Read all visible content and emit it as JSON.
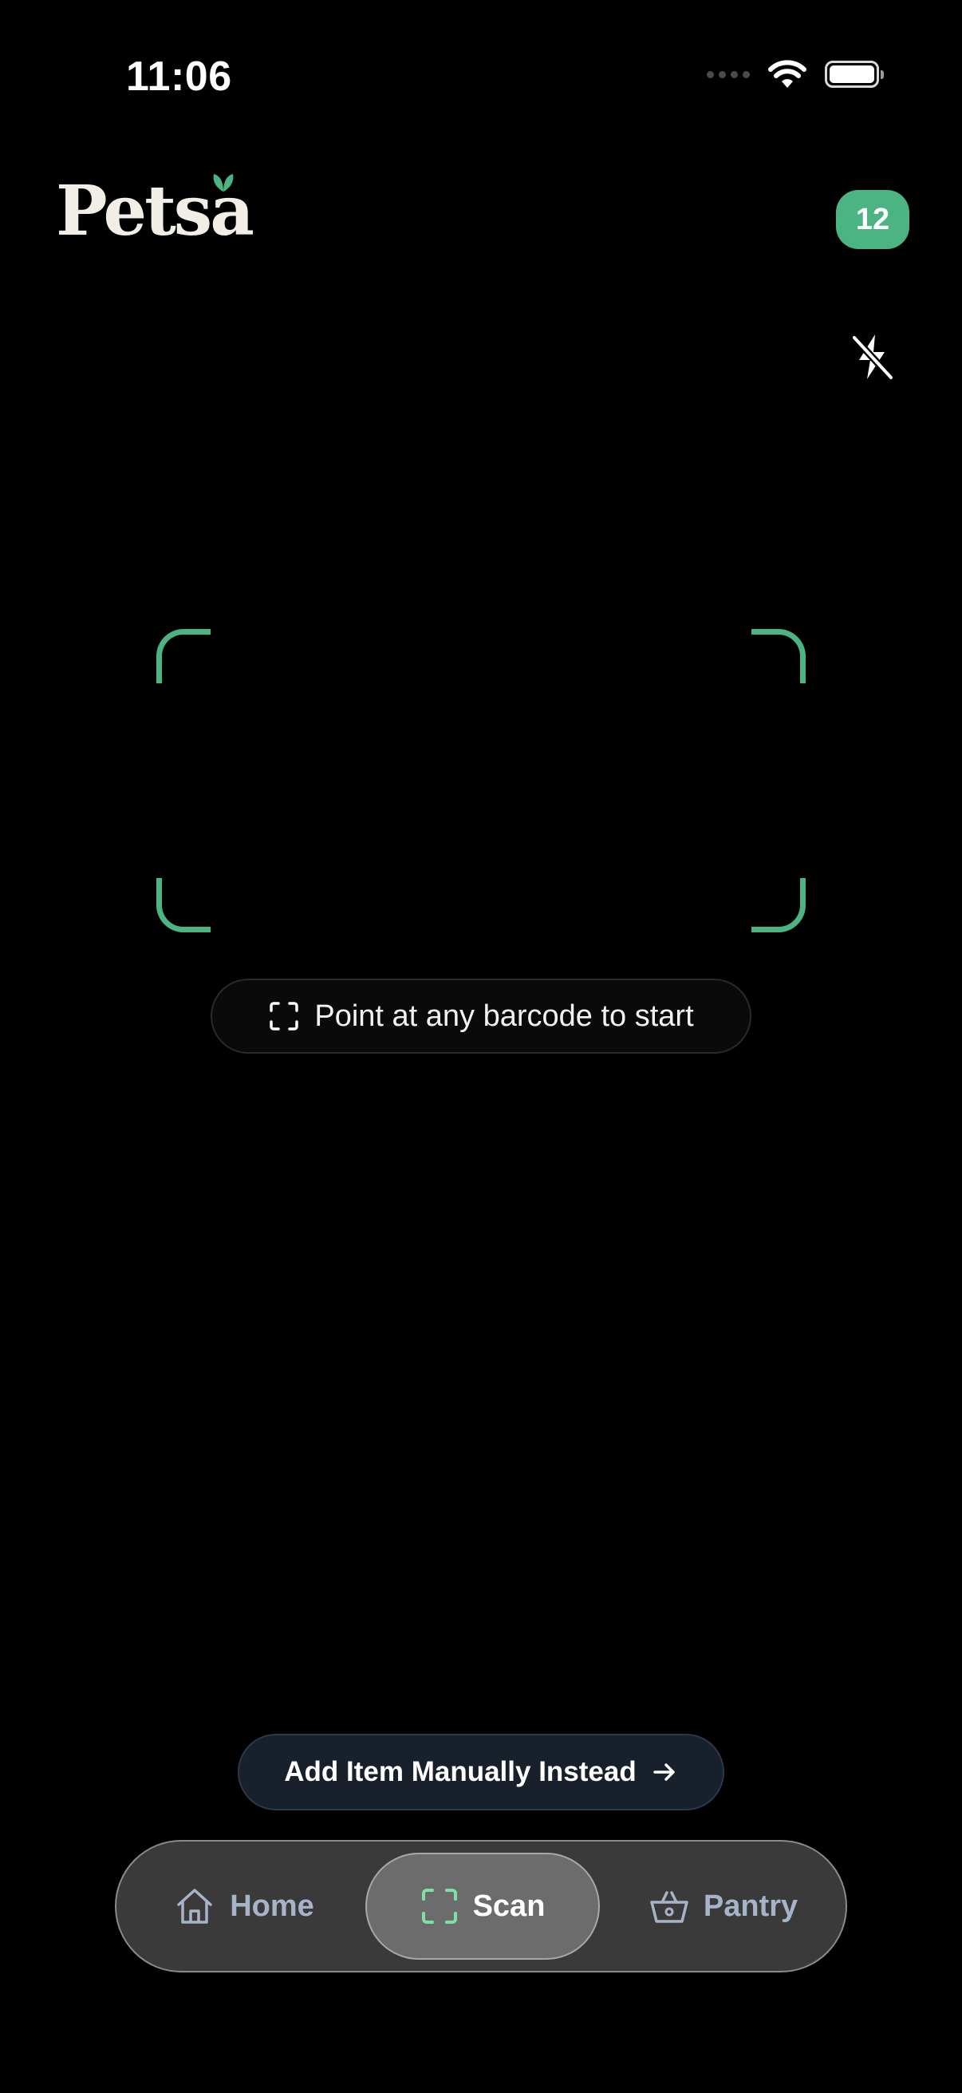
{
  "status_bar": {
    "time": "11:06"
  },
  "header": {
    "logo_text": "Petsa",
    "notification_count": "12"
  },
  "scanner": {
    "hint_text": "Point at any barcode to start"
  },
  "actions": {
    "manual_add_label": "Add Item Manually Instead"
  },
  "tab_bar": {
    "tabs": [
      {
        "label": "Home",
        "icon": "home-icon",
        "active": false
      },
      {
        "label": "Scan",
        "icon": "scan-icon",
        "active": true
      },
      {
        "label": "Pantry",
        "icon": "basket-icon",
        "active": false
      }
    ]
  },
  "colors": {
    "background": "#000000",
    "accent": "#4cb383",
    "tab_inactive": "#a7b4c8",
    "manual_button_bg": "#17202b"
  }
}
